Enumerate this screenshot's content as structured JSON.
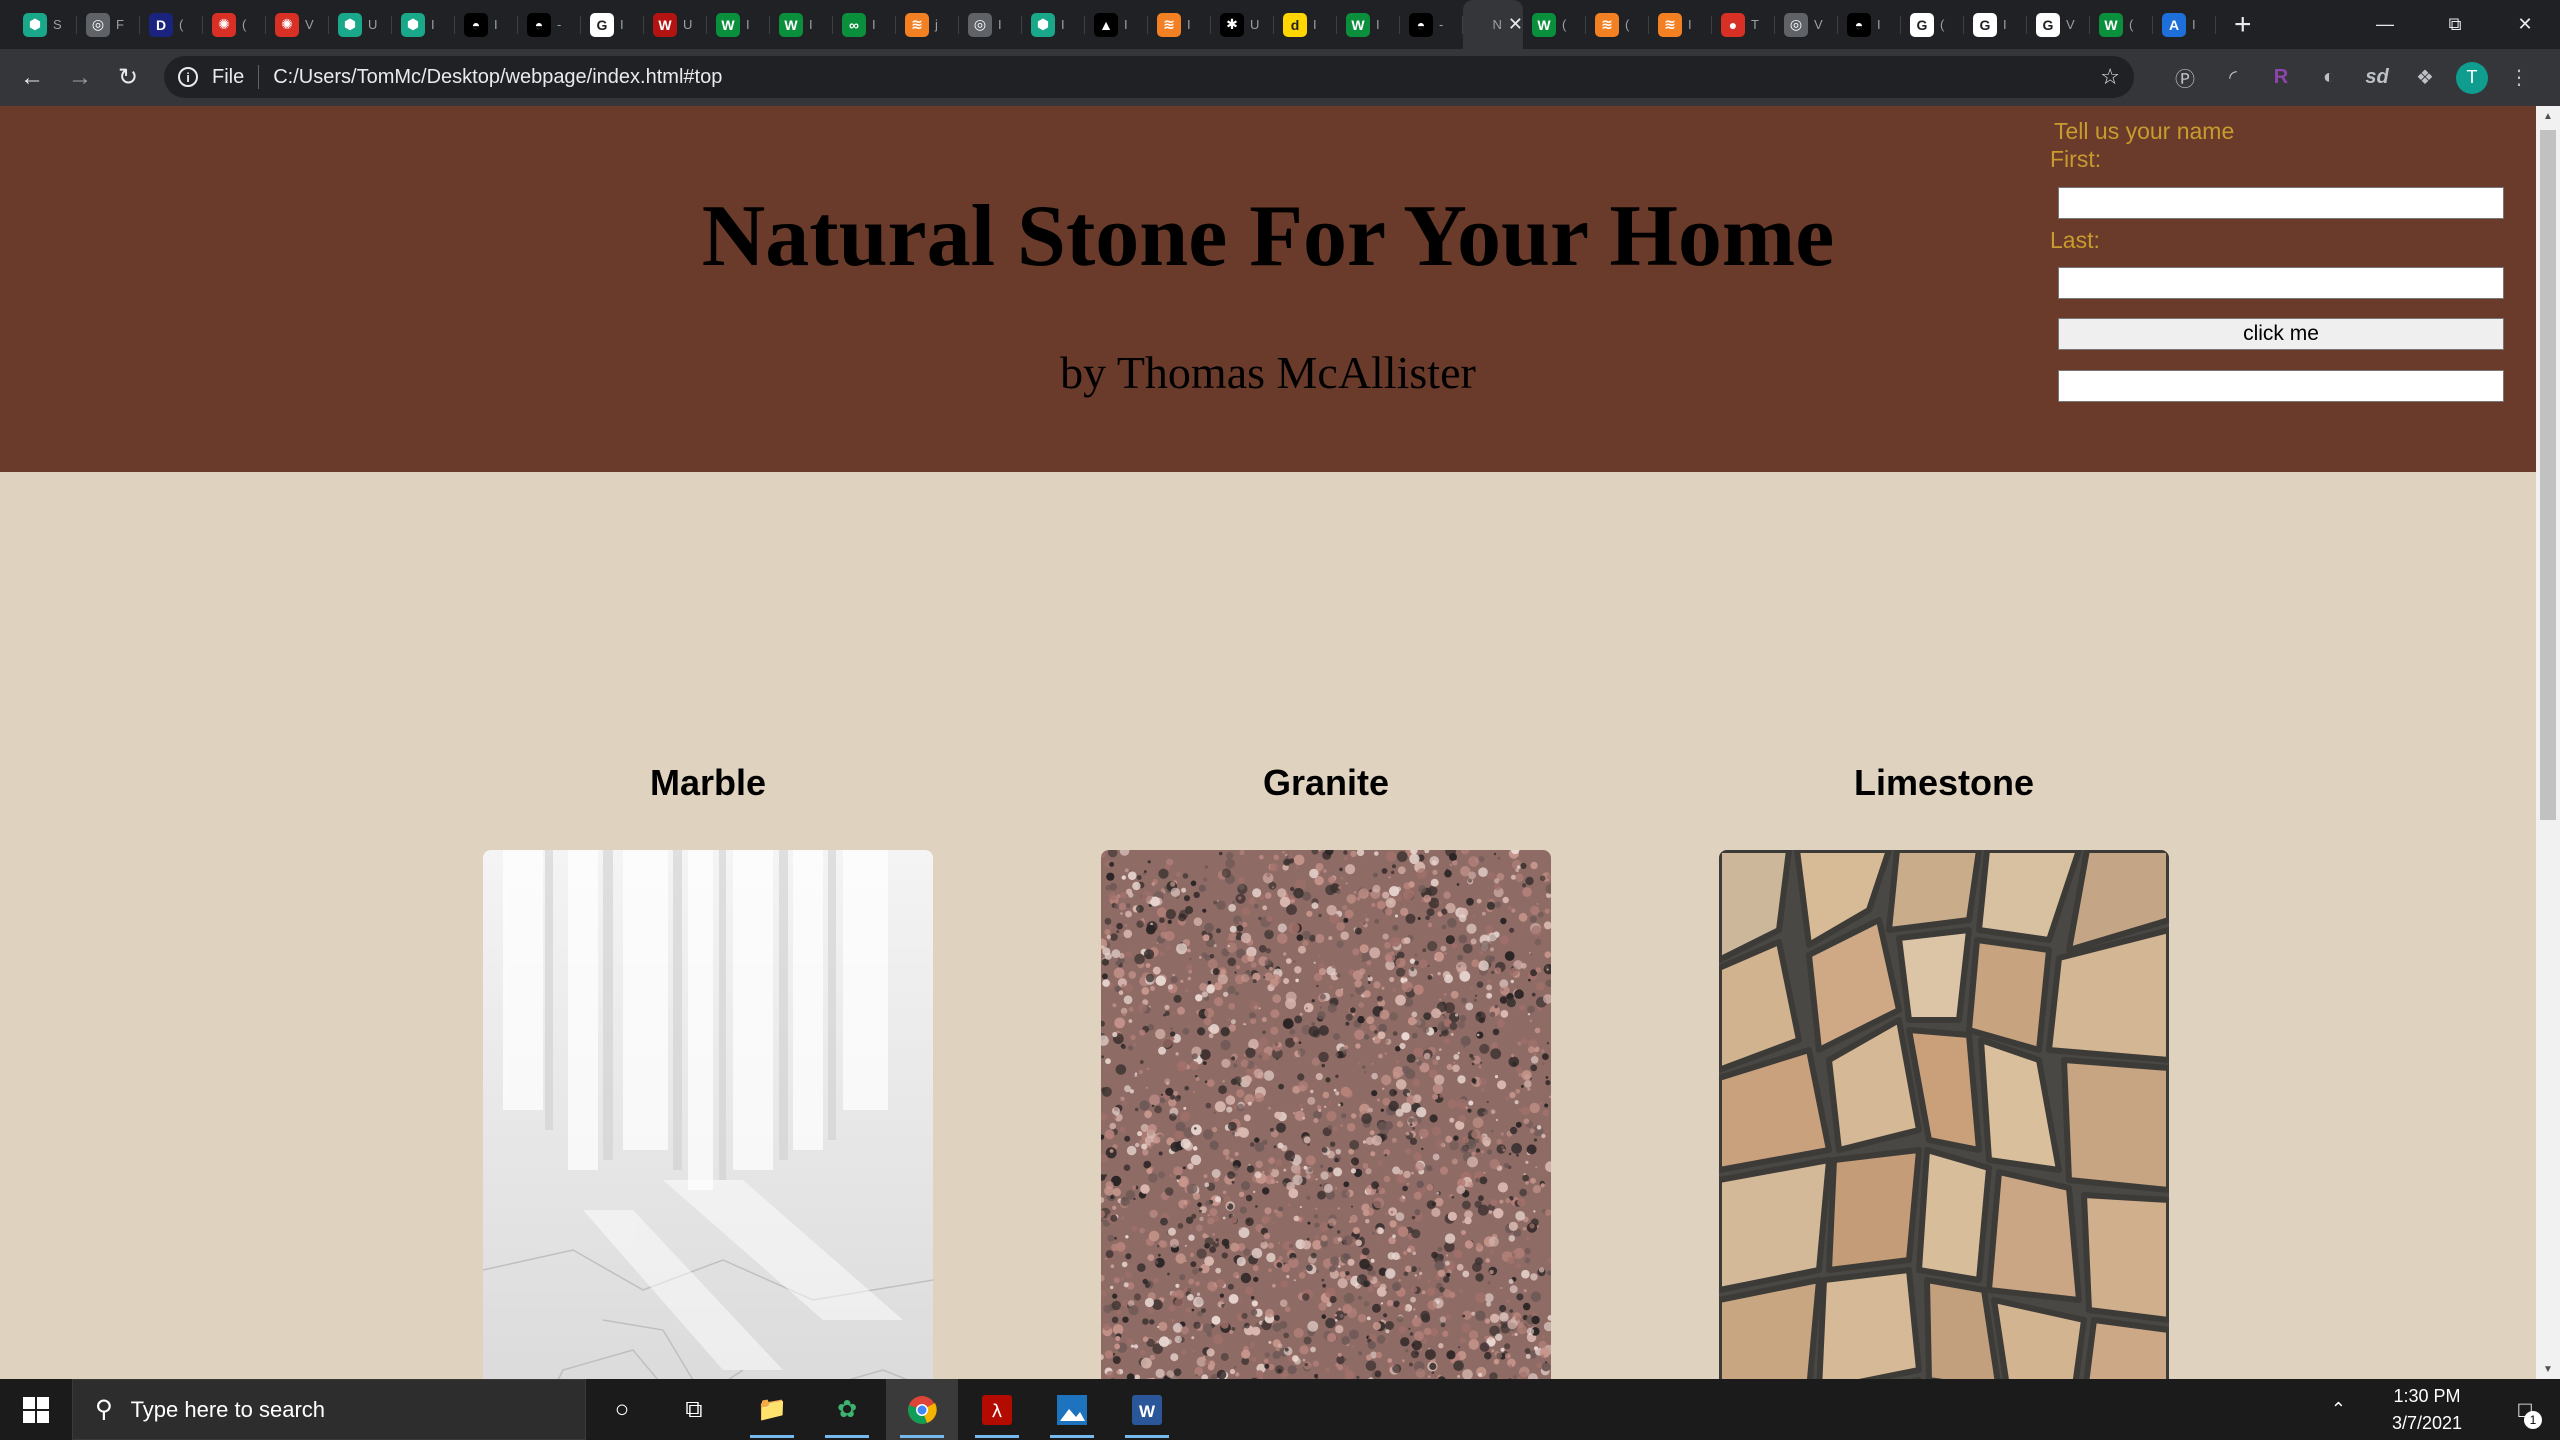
{
  "browser": {
    "tabs": [
      {
        "icon": "hexagon-icon",
        "color": "#1aa88a",
        "glyph": "⬢",
        "text": "S"
      },
      {
        "icon": "grey-circle-icon",
        "color": "#5f6368",
        "glyph": "◎",
        "text": "F"
      },
      {
        "icon": "dans-tools-icon",
        "color": "#1a237e",
        "glyph": "D",
        "text": "("
      },
      {
        "icon": "red-gear-icon",
        "color": "#d93025",
        "glyph": "✺",
        "text": "("
      },
      {
        "icon": "red-gear-icon",
        "color": "#d93025",
        "glyph": "✺",
        "text": "V"
      },
      {
        "icon": "hexagon-icon",
        "color": "#1aa88a",
        "glyph": "⬢",
        "text": "U"
      },
      {
        "icon": "hexagon-icon",
        "color": "#1aa88a",
        "glyph": "⬢",
        "text": "I"
      },
      {
        "icon": "cap-icon",
        "color": "#000000",
        "glyph": "◓",
        "text": "I"
      },
      {
        "icon": "cap-icon",
        "color": "#000000",
        "glyph": "◓",
        "text": "-"
      },
      {
        "icon": "google-icon",
        "color": "#ffffff",
        "glyph": "G",
        "text": "I"
      },
      {
        "icon": "iw-icon",
        "color": "#b31412",
        "glyph": "W",
        "text": "U"
      },
      {
        "icon": "w-icon",
        "color": "#0a8f3d",
        "glyph": "W",
        "text": "I"
      },
      {
        "icon": "w-icon",
        "color": "#0a8f3d",
        "glyph": "W",
        "text": "I"
      },
      {
        "icon": "wave-icon",
        "color": "#0a8f3d",
        "glyph": "∞",
        "text": "I"
      },
      {
        "icon": "stack-icon",
        "color": "#f48024",
        "glyph": "≋",
        "text": "j"
      },
      {
        "icon": "grey-circle-icon",
        "color": "#5f6368",
        "glyph": "◎",
        "text": "I"
      },
      {
        "icon": "hexagon-icon",
        "color": "#1aa88a",
        "glyph": "⬢",
        "text": "I"
      },
      {
        "icon": "triangle-icon",
        "color": "#000000",
        "glyph": "▲",
        "text": "I"
      },
      {
        "icon": "stack-icon",
        "color": "#f48024",
        "glyph": "≋",
        "text": "I"
      },
      {
        "icon": "bulb-icon",
        "color": "#000000",
        "glyph": "✱",
        "text": "U"
      },
      {
        "icon": "d-icon",
        "color": "#ffd600",
        "glyph": "d",
        "text": "I"
      },
      {
        "icon": "w-icon",
        "color": "#0a8f3d",
        "glyph": "W",
        "text": "I"
      },
      {
        "icon": "cap-icon",
        "color": "#000000",
        "glyph": "◓",
        "text": "-"
      },
      {
        "icon": "page-icon",
        "color": "#35363a",
        "glyph": "",
        "text": "N",
        "active": true
      },
      {
        "icon": "w-icon",
        "color": "#0a8f3d",
        "glyph": "W",
        "text": "("
      },
      {
        "icon": "stack-icon",
        "color": "#f48024",
        "glyph": "≋",
        "text": "("
      },
      {
        "icon": "stack-icon",
        "color": "#f48024",
        "glyph": "≋",
        "text": "I"
      },
      {
        "icon": "red-pin-icon",
        "color": "#d93025",
        "glyph": "●",
        "text": "T"
      },
      {
        "icon": "grey-circle-icon",
        "color": "#5f6368",
        "glyph": "◎",
        "text": "V"
      },
      {
        "icon": "cap-icon",
        "color": "#000000",
        "glyph": "◓",
        "text": "I"
      },
      {
        "icon": "google-icon",
        "color": "#ffffff",
        "glyph": "G",
        "text": "("
      },
      {
        "icon": "google-icon",
        "color": "#ffffff",
        "glyph": "G",
        "text": "I"
      },
      {
        "icon": "google-icon",
        "color": "#ffffff",
        "glyph": "G",
        "text": "V"
      },
      {
        "icon": "w-icon",
        "color": "#0a8f3d",
        "glyph": "W",
        "text": "("
      },
      {
        "icon": "az-icon",
        "color": "#1e6fd9",
        "glyph": "A",
        "text": "I"
      }
    ],
    "new_tab": "+",
    "file_label": "File",
    "url": "C:/Users/TomMc/Desktop/webpage/index.html#top",
    "avatar_letter": "T"
  },
  "page": {
    "title": "Natural Stone For Your Home",
    "byline": "by Thomas McAllister",
    "form": {
      "prompt": "Tell us your name",
      "first_label": "First:",
      "last_label": "Last:",
      "first_value": "",
      "last_value": "",
      "button_label": "click me",
      "output_value": ""
    },
    "stones": [
      {
        "name": "Marble"
      },
      {
        "name": "Granite"
      },
      {
        "name": "Limestone"
      }
    ],
    "colors": {
      "hero_bg": "#6a3a2b",
      "page_bg": "#dfd2bf",
      "form_text": "#c89b2e"
    }
  },
  "taskbar": {
    "search_placeholder": "Type here to search",
    "time": "1:30 PM",
    "date": "3/7/2021",
    "notification_count": "1"
  }
}
